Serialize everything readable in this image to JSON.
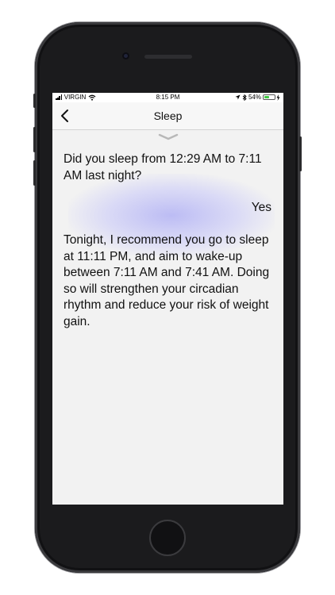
{
  "status_bar": {
    "carrier": "VIRGIN",
    "time": "8:15 PM",
    "battery": "54%",
    "battery_fraction": 0.54
  },
  "nav": {
    "title": "Sleep"
  },
  "conversation": {
    "question": "Did you sleep from 12:29 AM to 7:11 AM last night?",
    "answer": "Yes",
    "recommendation": "Tonight, I recommend you go to sleep at 11:11 PM, and aim to wake-up between 7:11 AM and 7:41 AM. Doing so will strengthen your circadian rhythm and reduce your risk of weight gain."
  },
  "colors": {
    "glow": "#aaaaf5",
    "battery_fill": "#40c843",
    "phone_body": "#1b1b1d"
  },
  "icons": [
    "signal-bars-icon",
    "wifi-icon",
    "location-arrow-icon",
    "bluetooth-icon",
    "battery-icon",
    "charging-bolt-icon",
    "back-chevron-icon",
    "pull-down-chevron-icon"
  ]
}
